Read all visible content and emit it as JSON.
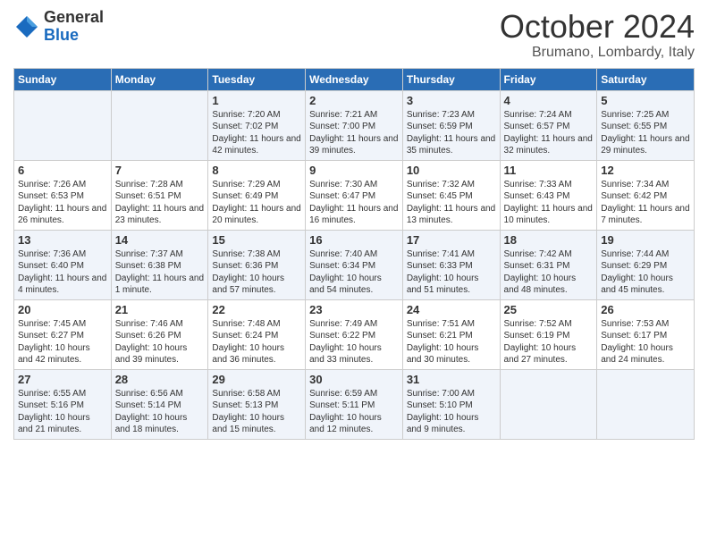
{
  "logo": {
    "general": "General",
    "blue": "Blue"
  },
  "title": "October 2024",
  "location": "Brumano, Lombardy, Italy",
  "days_header": [
    "Sunday",
    "Monday",
    "Tuesday",
    "Wednesday",
    "Thursday",
    "Friday",
    "Saturday"
  ],
  "weeks": [
    [
      {
        "day": "",
        "content": ""
      },
      {
        "day": "",
        "content": ""
      },
      {
        "day": "1",
        "content": "Sunrise: 7:20 AM\nSunset: 7:02 PM\nDaylight: 11 hours and 42 minutes."
      },
      {
        "day": "2",
        "content": "Sunrise: 7:21 AM\nSunset: 7:00 PM\nDaylight: 11 hours and 39 minutes."
      },
      {
        "day": "3",
        "content": "Sunrise: 7:23 AM\nSunset: 6:59 PM\nDaylight: 11 hours and 35 minutes."
      },
      {
        "day": "4",
        "content": "Sunrise: 7:24 AM\nSunset: 6:57 PM\nDaylight: 11 hours and 32 minutes."
      },
      {
        "day": "5",
        "content": "Sunrise: 7:25 AM\nSunset: 6:55 PM\nDaylight: 11 hours and 29 minutes."
      }
    ],
    [
      {
        "day": "6",
        "content": "Sunrise: 7:26 AM\nSunset: 6:53 PM\nDaylight: 11 hours and 26 minutes."
      },
      {
        "day": "7",
        "content": "Sunrise: 7:28 AM\nSunset: 6:51 PM\nDaylight: 11 hours and 23 minutes."
      },
      {
        "day": "8",
        "content": "Sunrise: 7:29 AM\nSunset: 6:49 PM\nDaylight: 11 hours and 20 minutes."
      },
      {
        "day": "9",
        "content": "Sunrise: 7:30 AM\nSunset: 6:47 PM\nDaylight: 11 hours and 16 minutes."
      },
      {
        "day": "10",
        "content": "Sunrise: 7:32 AM\nSunset: 6:45 PM\nDaylight: 11 hours and 13 minutes."
      },
      {
        "day": "11",
        "content": "Sunrise: 7:33 AM\nSunset: 6:43 PM\nDaylight: 11 hours and 10 minutes."
      },
      {
        "day": "12",
        "content": "Sunrise: 7:34 AM\nSunset: 6:42 PM\nDaylight: 11 hours and 7 minutes."
      }
    ],
    [
      {
        "day": "13",
        "content": "Sunrise: 7:36 AM\nSunset: 6:40 PM\nDaylight: 11 hours and 4 minutes."
      },
      {
        "day": "14",
        "content": "Sunrise: 7:37 AM\nSunset: 6:38 PM\nDaylight: 11 hours and 1 minute."
      },
      {
        "day": "15",
        "content": "Sunrise: 7:38 AM\nSunset: 6:36 PM\nDaylight: 10 hours and 57 minutes."
      },
      {
        "day": "16",
        "content": "Sunrise: 7:40 AM\nSunset: 6:34 PM\nDaylight: 10 hours and 54 minutes."
      },
      {
        "day": "17",
        "content": "Sunrise: 7:41 AM\nSunset: 6:33 PM\nDaylight: 10 hours and 51 minutes."
      },
      {
        "day": "18",
        "content": "Sunrise: 7:42 AM\nSunset: 6:31 PM\nDaylight: 10 hours and 48 minutes."
      },
      {
        "day": "19",
        "content": "Sunrise: 7:44 AM\nSunset: 6:29 PM\nDaylight: 10 hours and 45 minutes."
      }
    ],
    [
      {
        "day": "20",
        "content": "Sunrise: 7:45 AM\nSunset: 6:27 PM\nDaylight: 10 hours and 42 minutes."
      },
      {
        "day": "21",
        "content": "Sunrise: 7:46 AM\nSunset: 6:26 PM\nDaylight: 10 hours and 39 minutes."
      },
      {
        "day": "22",
        "content": "Sunrise: 7:48 AM\nSunset: 6:24 PM\nDaylight: 10 hours and 36 minutes."
      },
      {
        "day": "23",
        "content": "Sunrise: 7:49 AM\nSunset: 6:22 PM\nDaylight: 10 hours and 33 minutes."
      },
      {
        "day": "24",
        "content": "Sunrise: 7:51 AM\nSunset: 6:21 PM\nDaylight: 10 hours and 30 minutes."
      },
      {
        "day": "25",
        "content": "Sunrise: 7:52 AM\nSunset: 6:19 PM\nDaylight: 10 hours and 27 minutes."
      },
      {
        "day": "26",
        "content": "Sunrise: 7:53 AM\nSunset: 6:17 PM\nDaylight: 10 hours and 24 minutes."
      }
    ],
    [
      {
        "day": "27",
        "content": "Sunrise: 6:55 AM\nSunset: 5:16 PM\nDaylight: 10 hours and 21 minutes."
      },
      {
        "day": "28",
        "content": "Sunrise: 6:56 AM\nSunset: 5:14 PM\nDaylight: 10 hours and 18 minutes."
      },
      {
        "day": "29",
        "content": "Sunrise: 6:58 AM\nSunset: 5:13 PM\nDaylight: 10 hours and 15 minutes."
      },
      {
        "day": "30",
        "content": "Sunrise: 6:59 AM\nSunset: 5:11 PM\nDaylight: 10 hours and 12 minutes."
      },
      {
        "day": "31",
        "content": "Sunrise: 7:00 AM\nSunset: 5:10 PM\nDaylight: 10 hours and 9 minutes."
      },
      {
        "day": "",
        "content": ""
      },
      {
        "day": "",
        "content": ""
      }
    ]
  ]
}
